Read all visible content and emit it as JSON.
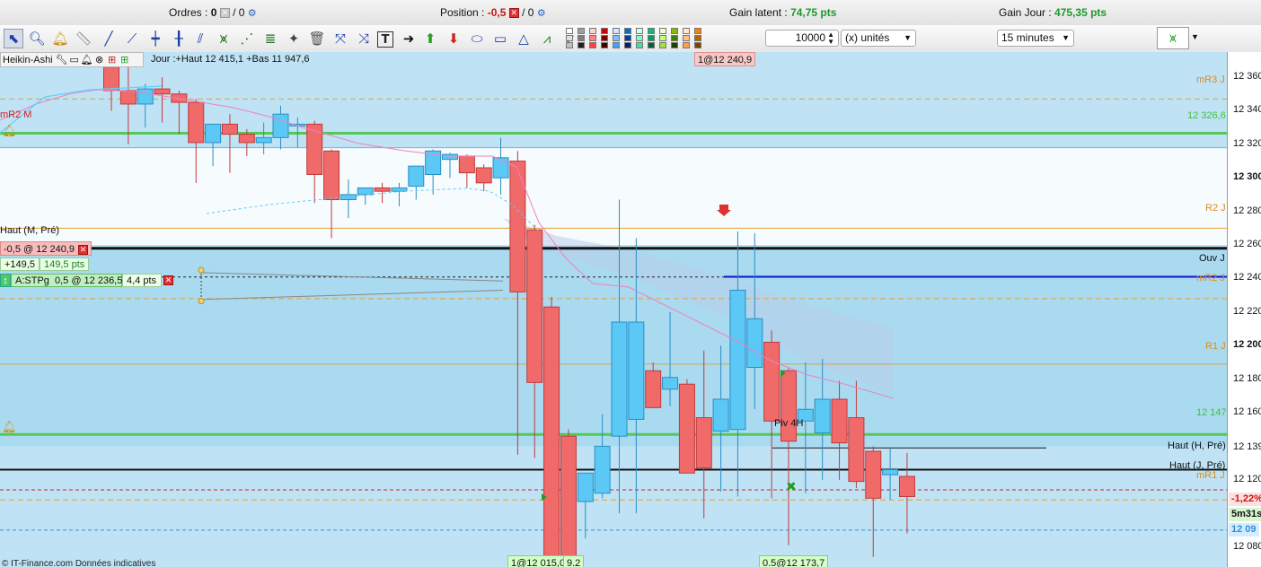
{
  "status_bar": {
    "orders_label": "Ordres :",
    "orders_value": "0",
    "orders_slash": "/ 0",
    "position_label": "Position :",
    "position_value": "-0,5",
    "position_slash": "/ 0",
    "gain_latent_label": "Gain latent :",
    "gain_latent_value": "74,75 pts",
    "gain_jour_label": "Gain Jour :",
    "gain_jour_value": "475,35 pts"
  },
  "toolbar": {
    "tools": [
      "pointer",
      "zoom",
      "alert-bell",
      "ruler",
      "line",
      "line-extended",
      "line-horizontal",
      "line-vertical",
      "parallel-lines",
      "trend",
      "channel",
      "fibonacci",
      "magic-wand",
      "trash",
      "arrow-cross",
      "arrows",
      "text",
      "arrow-right",
      "arrow-up-green",
      "arrow-down-red",
      "ellipse",
      "rectangle",
      "triangle",
      "zigzag",
      "zigzag-red"
    ],
    "swatches": [
      "#ffffff",
      "#e0e0e0",
      "#c0c0c0",
      "#a0a0a0",
      "#808080",
      "#202020",
      "#ffd0d0",
      "#ff8080",
      "#ff4040",
      "#d00000",
      "#800000",
      "#400000",
      "#d0e8ff",
      "#80c0ff",
      "#40a0ff",
      "#0070d0",
      "#0040a0",
      "#002060",
      "#d0ffe8",
      "#80ffc0",
      "#40e0a0",
      "#00c080",
      "#00a060",
      "#006040",
      "#e8ffd0",
      "#c0ff80",
      "#a0e040",
      "#80c000",
      "#408000",
      "#204000",
      "#ffe8d0",
      "#ffc080",
      "#ffa040",
      "#ff8000",
      "#c06000",
      "#804000"
    ],
    "quantity_value": "10000",
    "unit_select": "(x) unités",
    "interval_select": "15 minutes"
  },
  "chart": {
    "info_type": "Heikin-Ashi",
    "info_day": "Jour :+Haut 12 415,1 +Bas 11 947,6",
    "top_order_label": "1@12 240,9",
    "position_order": "-0,5 @ 12 240,9",
    "gain_points": "+149,5",
    "gain_pts": "149,5 pts",
    "stop_order": "A:STPg",
    "stop_value": "0,5 @ 12 236,5",
    "stop_pts": "4,4 pts",
    "bottom_order_1": "1@12 015,0",
    "bottom_order_1b": "9.2",
    "bottom_order_2": "0.5@12 173,7",
    "footer": "© IT-Finance.com  Données indicatives"
  },
  "levels": {
    "mr3j": "mR3 J",
    "mr2m": "mR2 M",
    "val_326": "12 326,6",
    "r2j": "R2 J",
    "haut_m_pre": "Haut (M, Pré)",
    "ouv_j": "Ouv J",
    "mr2j": "mR2 J",
    "r1j": "R1 J",
    "val_147": "12 147",
    "piv_4h": "Piv 4H",
    "haut_h_pre": "Haut (H, Pré)",
    "haut_j_pre": "Haut (J, Pré)",
    "mr1j": "mR1 J"
  },
  "price_axis": {
    "ticks": [
      "12 360",
      "12 340",
      "12 320",
      "12 300",
      "12 280",
      "12 260",
      "12 240",
      "12 220",
      "12 200",
      "12 180",
      "12 160",
      "12 139",
      "12 120",
      "12 080"
    ],
    "tag_pct": "-1,22%",
    "tag_timer": "5m31s",
    "tag_price": "12 09"
  },
  "colors": {
    "up": "#5bc8f5",
    "down": "#f06a6a",
    "green_level": "#55c855",
    "orange_level": "#e8a030",
    "blue_level": "#1010c8",
    "band_light": "#bfe3f5",
    "band_dark": "#a9daf0"
  },
  "chart_data": {
    "type": "candlestick",
    "style": "Heikin-Ashi",
    "interval": "15 minutes",
    "ylim": [
      12068,
      12375
    ],
    "price_labels": [
      12360,
      12340,
      12320,
      12300,
      12280,
      12260,
      12240,
      12220,
      12200,
      12180,
      12160,
      12139,
      12120,
      12080
    ],
    "candles": [
      {
        "o": 12366,
        "h": 12375,
        "l": 12340,
        "c": 12352
      },
      {
        "o": 12352,
        "h": 12368,
        "l": 12320,
        "c": 12344
      },
      {
        "o": 12344,
        "h": 12356,
        "l": 12330,
        "c": 12353
      },
      {
        "o": 12353,
        "h": 12360,
        "l": 12333,
        "c": 12350
      },
      {
        "o": 12350,
        "h": 12352,
        "l": 12326,
        "c": 12345
      },
      {
        "o": 12345,
        "h": 12347,
        "l": 12297,
        "c": 12321
      },
      {
        "o": 12321,
        "h": 12329,
        "l": 12307,
        "c": 12332
      },
      {
        "o": 12332,
        "h": 12338,
        "l": 12303,
        "c": 12326
      },
      {
        "o": 12326,
        "h": 12329,
        "l": 12313,
        "c": 12321
      },
      {
        "o": 12321,
        "h": 12333,
        "l": 12314,
        "c": 12324
      },
      {
        "o": 12324,
        "h": 12343,
        "l": 12317,
        "c": 12338
      },
      {
        "o": 12332,
        "h": 12336,
        "l": 12318,
        "c": 12332
      },
      {
        "o": 12332,
        "h": 12334,
        "l": 12285,
        "c": 12302
      },
      {
        "o": 12316,
        "h": 12317,
        "l": 12264,
        "c": 12287
      },
      {
        "o": 12287,
        "h": 12299,
        "l": 12276,
        "c": 12290
      },
      {
        "o": 12290,
        "h": 12294,
        "l": 12284,
        "c": 12294
      },
      {
        "o": 12294,
        "h": 12297,
        "l": 12285,
        "c": 12292
      },
      {
        "o": 12292,
        "h": 12297,
        "l": 12283,
        "c": 12294
      },
      {
        "o": 12295,
        "h": 12307,
        "l": 12287,
        "c": 12307
      },
      {
        "o": 12302,
        "h": 12317,
        "l": 12290,
        "c": 12316
      },
      {
        "o": 12311,
        "h": 12315,
        "l": 12300,
        "c": 12314
      },
      {
        "o": 12313,
        "h": 12314,
        "l": 12294,
        "c": 12303
      },
      {
        "o": 12306,
        "h": 12308,
        "l": 12292,
        "c": 12297
      },
      {
        "o": 12300,
        "h": 12324,
        "l": 12290,
        "c": 12312
      },
      {
        "o": 12310,
        "h": 12316,
        "l": 12135,
        "c": 12232
      },
      {
        "o": 12269,
        "h": 12272,
        "l": 12133,
        "c": 12178
      },
      {
        "o": 12223,
        "h": 12229,
        "l": 12070,
        "c": 12071
      },
      {
        "o": 12146,
        "h": 12150,
        "l": 12070,
        "c": 12060
      },
      {
        "o": 12107,
        "h": 12120,
        "l": 12085,
        "c": 12124
      },
      {
        "o": 12112,
        "h": 12159,
        "l": 12109,
        "c": 12140
      },
      {
        "o": 12146,
        "h": 12287,
        "l": 12100,
        "c": 12214
      },
      {
        "o": 12156,
        "h": 12264,
        "l": 12100,
        "c": 12214
      },
      {
        "o": 12185,
        "h": 12190,
        "l": 12168,
        "c": 12163
      },
      {
        "o": 12174,
        "h": 12220,
        "l": 12164,
        "c": 12181
      },
      {
        "o": 12177,
        "h": 12180,
        "l": 12145,
        "c": 12124
      },
      {
        "o": 12157,
        "h": 12197,
        "l": 12097,
        "c": 12127
      },
      {
        "o": 12149,
        "h": 12200,
        "l": 12113,
        "c": 12168
      },
      {
        "o": 12150,
        "h": 12268,
        "l": 12110,
        "c": 12233
      },
      {
        "o": 12187,
        "h": 12267,
        "l": 12162,
        "c": 12216
      },
      {
        "o": 12202,
        "h": 12209,
        "l": 12109,
        "c": 12155
      },
      {
        "o": 12185,
        "h": 12187,
        "l": 12081,
        "c": 12143
      },
      {
        "o": 12155,
        "h": 12190,
        "l": 12112,
        "c": 12162
      },
      {
        "o": 12148,
        "h": 12192,
        "l": 12120,
        "c": 12168
      },
      {
        "o": 12168,
        "h": 12179,
        "l": 12120,
        "c": 12142
      },
      {
        "o": 12157,
        "h": 12179,
        "l": 12115,
        "c": 12119
      },
      {
        "o": 12137,
        "h": 12140,
        "l": 12074,
        "c": 12109
      },
      {
        "o": 12123,
        "h": 12139,
        "l": 12108,
        "c": 12126
      },
      {
        "o": 12122,
        "h": 12136,
        "l": 12088,
        "c": 12110
      }
    ]
  }
}
